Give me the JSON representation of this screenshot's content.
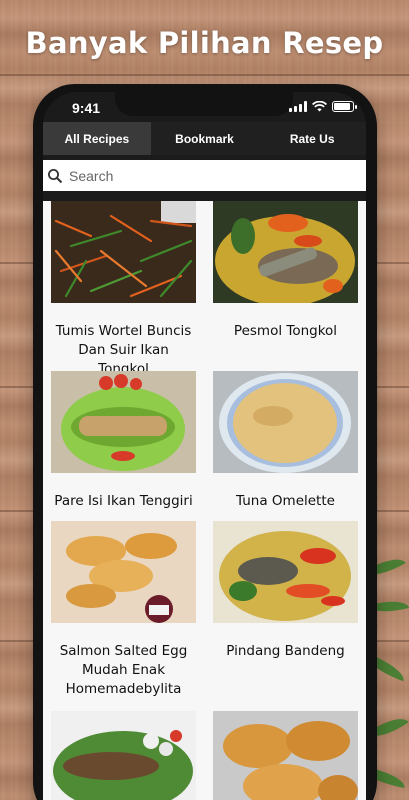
{
  "headline": "Banyak Pilihan Resep",
  "status_bar": {
    "time": "9:41",
    "battery_level": 0.9
  },
  "tabs": [
    {
      "label": "All Recipes",
      "active": true
    },
    {
      "label": "Bookmark",
      "active": false
    },
    {
      "label": "Rate Us",
      "active": false
    }
  ],
  "search": {
    "placeholder": "Search"
  },
  "recipes": [
    {
      "title": "Tumis Wortel Buncis Dan Suir Ikan Tongkol"
    },
    {
      "title": "Pesmol Tongkol"
    },
    {
      "title": "Pare Isi Ikan Tenggiri"
    },
    {
      "title": "Tuna Omelette"
    },
    {
      "title": "Salmon Salted Egg Mudah Enak Homemadebylita"
    },
    {
      "title": "Pindang Bandeng"
    },
    {
      "title": ""
    },
    {
      "title": ""
    }
  ],
  "colors": {
    "accent_bar": "#1b1b1b",
    "active_tab": "#3a3a3a",
    "grid_bg": "#f7f7f7"
  }
}
